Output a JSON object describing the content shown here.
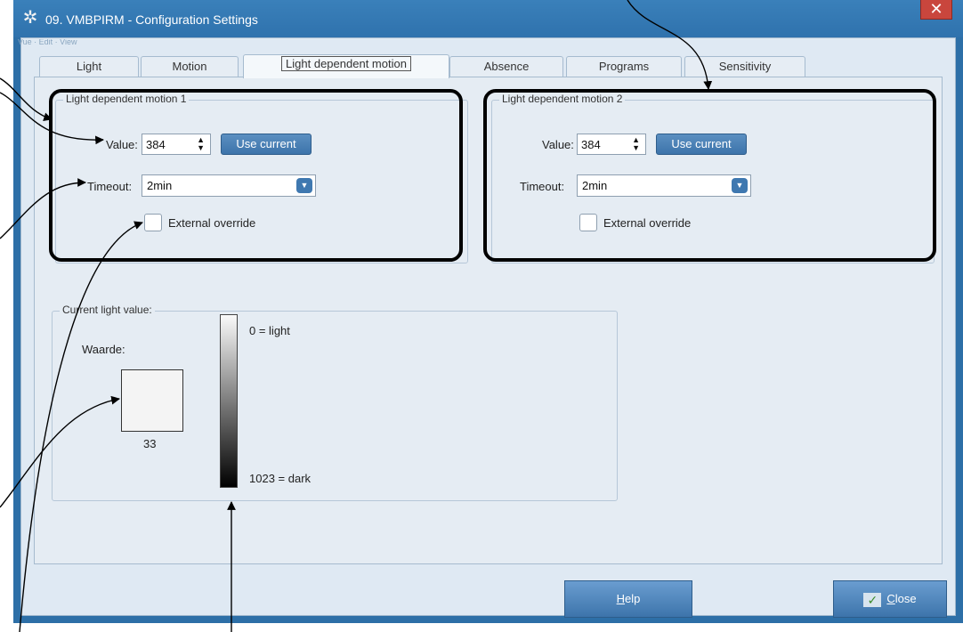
{
  "window": {
    "title": "09. VMBPIRM - Configuration Settings",
    "close_glyph": "✕",
    "ghost_menu": "Vue · Edit · View"
  },
  "tabs": [
    {
      "label": "Light"
    },
    {
      "label": "Motion"
    },
    {
      "label": "Light dependent motion"
    },
    {
      "label": "Absence"
    },
    {
      "label": "Programs"
    },
    {
      "label": "Sensitivity"
    }
  ],
  "ldm1": {
    "title": "Light dependent motion 1",
    "value_label": "Value:",
    "value": "384",
    "use_current": "Use current",
    "timeout_label": "Timeout:",
    "timeout": "2min",
    "override_label": "External override"
  },
  "ldm2": {
    "title": "Light dependent motion 2",
    "value_label": "Value:",
    "value": "384",
    "use_current": "Use current",
    "timeout_label": "Timeout:",
    "timeout": "2min",
    "override_label": "External override"
  },
  "current_light": {
    "title": "Current light value:",
    "waarde_label": "Waarde:",
    "reading": "33",
    "scale_top": "0 = light",
    "scale_bottom": "1023 = dark"
  },
  "footer": {
    "help_prefix": "",
    "help_underline": "H",
    "help_rest": "elp",
    "close_underline": "C",
    "close_rest": "lose"
  },
  "icons": {
    "title": "gear-icon",
    "spin": "spin-arrows-icon",
    "dropdown": "chevron-down-icon",
    "close_btn": "checkmark-icon"
  },
  "colors": {
    "titlebar": "#2f72ad",
    "button_blue": "#3d74aa",
    "close_red": "#c9463d",
    "annotation": "#000000"
  }
}
